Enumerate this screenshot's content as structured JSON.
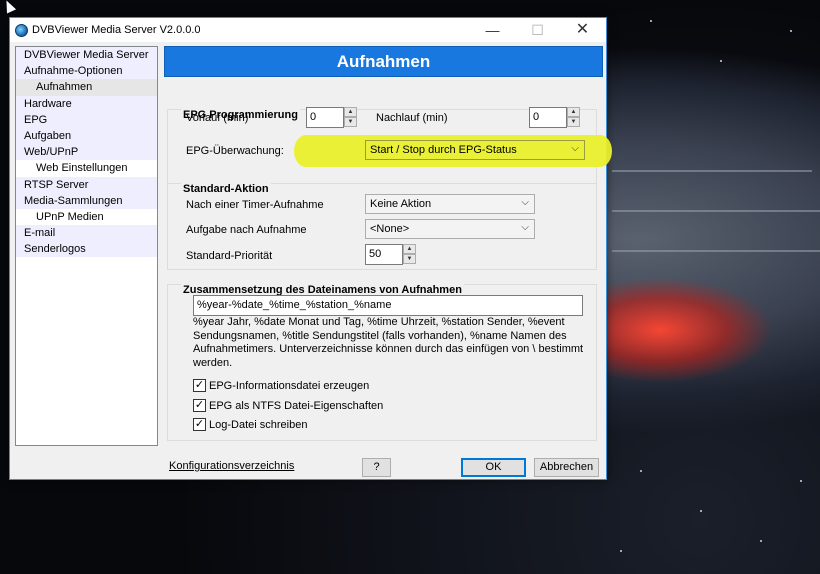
{
  "window": {
    "title": "DVBViewer Media Server V2.0.0.0",
    "controls": {
      "minimize": "—",
      "maximize": "☐",
      "close": "✕"
    }
  },
  "sidebar": {
    "items": [
      {
        "label": "DVBViewer Media Server",
        "level": 0
      },
      {
        "label": "Aufnahme-Optionen",
        "level": 0
      },
      {
        "label": "Aufnahmen",
        "level": 1,
        "selected": true
      },
      {
        "label": "Hardware",
        "level": 0
      },
      {
        "label": "EPG",
        "level": 0
      },
      {
        "label": "Aufgaben",
        "level": 0
      },
      {
        "label": "Web/UPnP",
        "level": 0
      },
      {
        "label": "Web Einstellungen",
        "level": 1
      },
      {
        "label": "RTSP Server",
        "level": 0
      },
      {
        "label": "Media-Sammlungen",
        "level": 0
      },
      {
        "label": "UPnP Medien",
        "level": 1
      },
      {
        "label": "E-mail",
        "level": 0
      },
      {
        "label": "Senderlogos",
        "level": 0
      }
    ]
  },
  "header": {
    "title": "Aufnahmen"
  },
  "epg": {
    "group_title": "EPG Programmierung",
    "vorlauf_label": "Vorlauf (min)",
    "vorlauf_value": "0",
    "nachlauf_label": "Nachlauf (min)",
    "nachlauf_value": "0",
    "monitor_label": "EPG-Überwachung:",
    "monitor_value": "Start / Stop durch EPG-Status"
  },
  "standard": {
    "group_title": "Standard-Aktion",
    "after_timer_label": "Nach einer Timer-Aufnahme",
    "after_timer_value": "Keine Aktion",
    "task_label": "Aufgabe nach Aufnahme",
    "task_value": "<None>",
    "priority_label": "Standard-Priorität",
    "priority_value": "50"
  },
  "filename": {
    "group_title": "Zusammensetzung des Dateinamens von Aufnahmen",
    "pattern": "%year-%date_%time_%station_%name",
    "description": "%year Jahr, %date Monat und Tag, %time Uhrzeit, %station Sender, %event Sendungsnamen, %title Sendungstitel (falls vorhanden), %name Namen des Aufnahmetimers. Unterverzeichnisse können durch das einfügen von \\ bestimmt werden.",
    "checkboxes": [
      {
        "label": "EPG-Informationsdatei erzeugen",
        "checked": true
      },
      {
        "label": "EPG als NTFS Datei-Eigenschaften",
        "checked": true
      },
      {
        "label": "Log-Datei schreiben",
        "checked": true
      }
    ]
  },
  "footer": {
    "config_link": "Konfigurationsverzeichnis",
    "help_label": "?",
    "ok_label": "OK",
    "cancel_label": "Abbrechen"
  },
  "colors": {
    "header_bg": "#1878e0",
    "highlight": "#e9ef2a",
    "nav_top_bg": "#eeeeff"
  }
}
